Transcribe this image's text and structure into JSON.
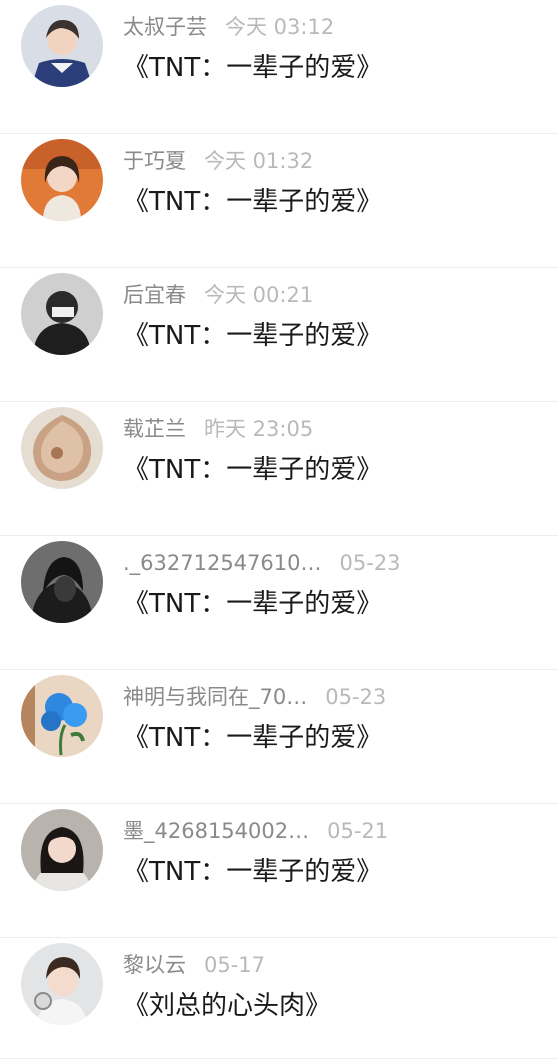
{
  "messages": [
    {
      "name": "太叔子芸",
      "time": "今天 03:12",
      "title": "《TNT：一辈子的爱》",
      "avatar_icon": "user-avatar-icon"
    },
    {
      "name": "于巧夏",
      "time": "今天 01:32",
      "title": "《TNT：一辈子的爱》",
      "avatar_icon": "user-avatar-icon"
    },
    {
      "name": "后宜春",
      "time": "今天 00:21",
      "title": "《TNT：一辈子的爱》",
      "avatar_icon": "user-avatar-icon"
    },
    {
      "name": "载芷兰",
      "time": "昨天 23:05",
      "title": "《TNT：一辈子的爱》",
      "avatar_icon": "user-avatar-icon"
    },
    {
      "name": "._632712547610…",
      "time": "05-23",
      "title": "《TNT：一辈子的爱》",
      "avatar_icon": "user-avatar-icon"
    },
    {
      "name": "神明与我同在_70…",
      "time": "05-23",
      "title": "《TNT：一辈子的爱》",
      "avatar_icon": "user-avatar-icon"
    },
    {
      "name": "墨_4268154002…",
      "time": "05-21",
      "title": "《TNT：一辈子的爱》",
      "avatar_icon": "user-avatar-icon"
    },
    {
      "name": "黎以云",
      "time": "05-17",
      "title": "《刘总的心头肉》",
      "avatar_icon": "user-avatar-icon"
    }
  ],
  "colors": {
    "name_text": "#8a8a8a",
    "time_text": "#b9b9b9",
    "title_text": "#1a1a1a",
    "divider": "#eeeeee"
  }
}
